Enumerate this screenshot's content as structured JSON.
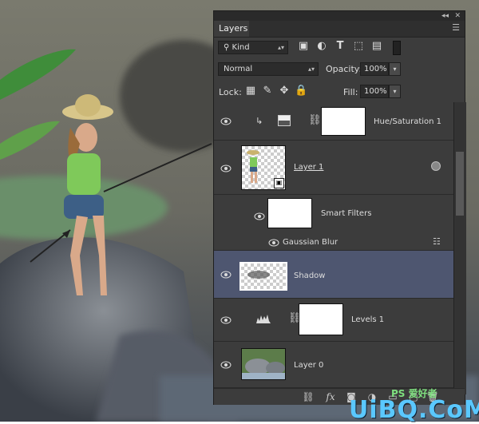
{
  "panel": {
    "tab_label": "Layers",
    "filter_kind": "Kind",
    "blend_mode": "Normal",
    "opacity_label": "Opacity:",
    "opacity_value": "100%",
    "lock_label": "Lock:",
    "fill_label": "Fill:",
    "fill_value": "100%"
  },
  "layers": [
    {
      "name": "Hue/Saturation 1",
      "kind": "adjustment",
      "selected": false
    },
    {
      "name": "Layer 1",
      "kind": "smart-object",
      "selected": false
    },
    {
      "name": "Smart Filters",
      "kind": "smart-filters",
      "selected": false
    },
    {
      "name": "Gaussian Blur",
      "kind": "filter",
      "selected": false
    },
    {
      "name": "Shadow",
      "kind": "pixel",
      "selected": true
    },
    {
      "name": "Levels 1",
      "kind": "adjustment",
      "selected": false
    },
    {
      "name": "Layer 0",
      "kind": "pixel",
      "selected": false
    }
  ],
  "watermark": {
    "main": "UiBQ.CoM",
    "sub": "PS 爱好者"
  },
  "colors": {
    "panel_bg": "#3c3c3c",
    "selected_row": "#4e5670",
    "watermark": "#5ac8ff"
  }
}
